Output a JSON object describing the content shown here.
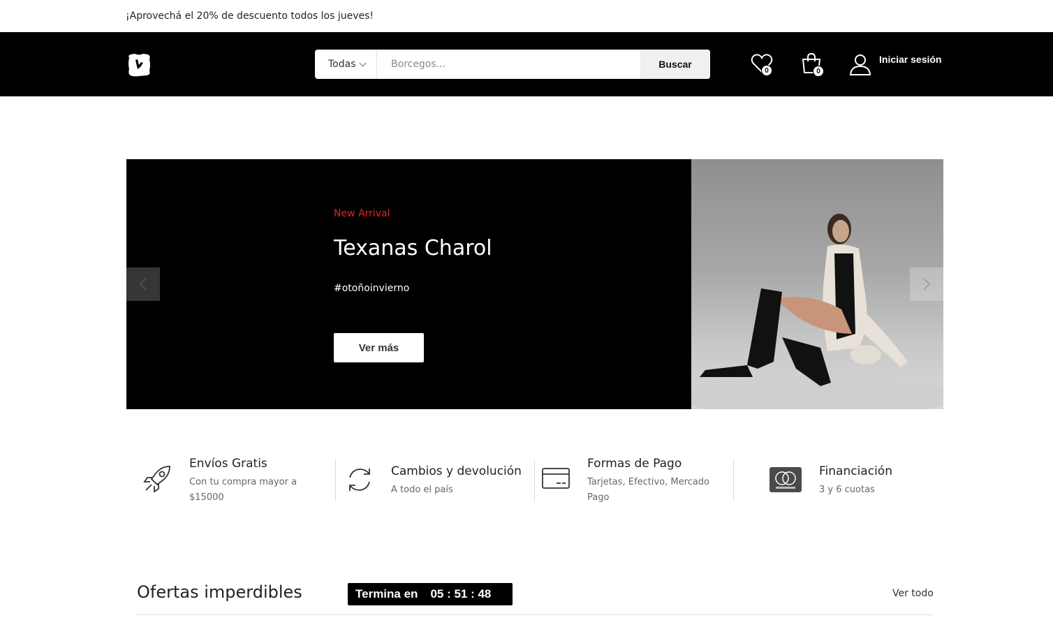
{
  "topbar": {
    "promo": "¡Aprovechá el 20% de descuento todos los jueves!"
  },
  "header": {
    "search": {
      "category": "Todas",
      "placeholder": "Borcegos...",
      "button": "Buscar"
    },
    "wishlist_count": "0",
    "cart_count": "0",
    "login_label": "Iniciar sesión"
  },
  "hero": {
    "tag": "New Arrival",
    "title": "Texanas Charol",
    "hashtag": "#otoñoinvierno",
    "button": "Ver más"
  },
  "features": [
    {
      "icon": "rocket-icon",
      "title": "Envíos Gratis",
      "subtitle": "Con tu compra mayor a $15000"
    },
    {
      "icon": "refresh-icon",
      "title": "Cambios y devolución",
      "subtitle": "A todo el país"
    },
    {
      "icon": "credit-card-icon",
      "title": "Formas de Pago",
      "subtitle": "Tarjetas, Efectivo, Mercado Pago"
    },
    {
      "icon": "mastercard-icon",
      "title": "Financiación",
      "subtitle": "3 y 6 cuotas"
    }
  ],
  "offers": {
    "title": "Ofertas imperdibles",
    "timer_label": "Termina en",
    "timer_value": "05 : 51 : 48",
    "see_all": "Ver todo"
  },
  "colors": {
    "header_bg": "#000000",
    "accent_red": "#e32222"
  }
}
